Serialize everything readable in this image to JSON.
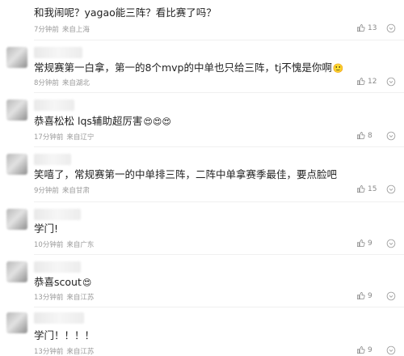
{
  "comments": [
    {
      "text": "和我闹呢？yagao能三阵？看比赛了吗？",
      "emojis": "",
      "time": "7分钟前",
      "location": "来自上海",
      "likes": "13"
    },
    {
      "text": "常规赛第一白拿，第一的8个mvp的中单也只给三阵，tj不愧是你啊",
      "emojis": "🙂",
      "time": "8分钟前",
      "location": "来自湖北",
      "likes": "12"
    },
    {
      "text": "恭喜松松 lqs辅助超厉害",
      "emojis": "😍😍😍",
      "time": "17分钟前",
      "location": "来自辽宁",
      "likes": "8"
    },
    {
      "text": "笑嘻了，常规赛第一的中单排三阵，二阵中单拿赛季最佳，要点脸吧",
      "emojis": "",
      "time": "9分钟前",
      "location": "来自甘肃",
      "likes": "15"
    },
    {
      "text": "学门!",
      "emojis": "",
      "time": "10分钟前",
      "location": "来自广东",
      "likes": "9"
    },
    {
      "text": "恭喜scout",
      "emojis": "😍",
      "time": "13分钟前",
      "location": "来自江苏",
      "likes": "9"
    },
    {
      "text": "学门！！！！",
      "emojis": "",
      "time": "13分钟前",
      "location": "来自江苏",
      "likes": "9"
    }
  ],
  "icons": {
    "like": "thumbs-up-icon",
    "more": "more-circle-icon"
  },
  "colors": {
    "meta": "#9a9a9a",
    "text": "#222222",
    "icon": "#888888"
  }
}
